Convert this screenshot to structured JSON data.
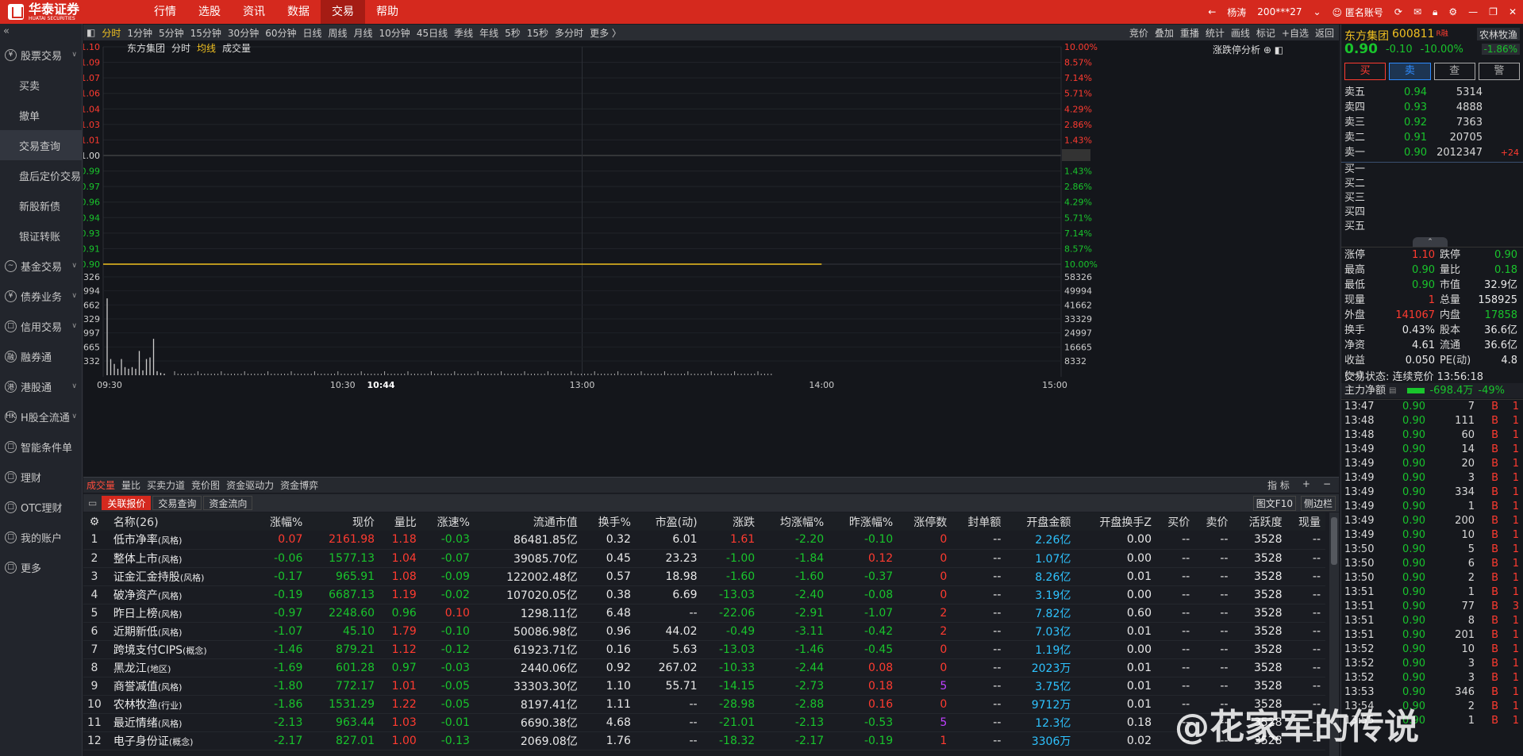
{
  "app": {
    "brand": "华泰证券",
    "brand_en": "HUATAI SECURITIES"
  },
  "menu": [
    {
      "label": "行情",
      "active": false
    },
    {
      "label": "选股",
      "active": false
    },
    {
      "label": "资讯",
      "active": false
    },
    {
      "label": "数据",
      "active": false
    },
    {
      "label": "交易",
      "active": true
    },
    {
      "label": "帮助",
      "active": false
    }
  ],
  "topright": {
    "user": "杨涛",
    "account": "200***27",
    "anon": "匿名账号"
  },
  "sidebar": [
    {
      "label": "股票交易",
      "icon": "¥",
      "chev": true,
      "sub": false
    },
    {
      "label": "买卖",
      "sub": true
    },
    {
      "label": "撤单",
      "sub": true
    },
    {
      "label": "交易查询",
      "sub": true,
      "active": true
    },
    {
      "label": "盘后定价交易",
      "sub": true
    },
    {
      "label": "新股新债",
      "sub": true
    },
    {
      "label": "银证转账",
      "sub": true
    },
    {
      "label": "基金交易",
      "icon": "~",
      "chev": true,
      "sub": false
    },
    {
      "label": "债券业务",
      "icon": "¥",
      "chev": true,
      "sub": false
    },
    {
      "label": "信用交易",
      "icon": "□",
      "chev": true,
      "sub": false
    },
    {
      "label": "融券通",
      "icon": "融",
      "sub": false
    },
    {
      "label": "港股通",
      "icon": "港",
      "chev": true,
      "sub": false
    },
    {
      "label": "H股全流通",
      "icon": "HK",
      "chev": true,
      "sub": false
    },
    {
      "label": "智能条件单",
      "icon": "□",
      "sub": false
    },
    {
      "label": "理财",
      "icon": "□",
      "sub": false
    },
    {
      "label": "OTC理财",
      "icon": "□",
      "sub": false
    },
    {
      "label": "我的账户",
      "icon": "□",
      "sub": false
    },
    {
      "label": "更多",
      "icon": "□",
      "sub": false
    }
  ],
  "chart_tools": {
    "periods": [
      "分时",
      "1分钟",
      "5分钟",
      "15分钟",
      "30分钟",
      "60分钟",
      "日线",
      "周线",
      "月线",
      "10分钟",
      "45日线",
      "季线",
      "年线",
      "5秒",
      "15秒",
      "多分时",
      "更多 〉"
    ],
    "right": [
      "竞价",
      "叠加",
      "重播",
      "统计",
      "画线",
      "标记",
      "+自选",
      "返回"
    ]
  },
  "chart_legend": {
    "name": "东方集团",
    "mode": "分时",
    "avg": "均线",
    "vol": "成交量",
    "right": "涨跌停分析"
  },
  "chart_data": {
    "type": "line",
    "title": "东方集团 分时",
    "price_ticks": [
      "1.10",
      "1.09",
      "1.07",
      "1.06",
      "1.04",
      "1.03",
      "1.01",
      "1.00",
      "0.99",
      "0.97",
      "0.96",
      "0.94",
      "0.93",
      "0.91",
      "0.90"
    ],
    "pct_ticks": [
      "10.00%",
      "8.57%",
      "7.14%",
      "5.71%",
      "4.29%",
      "2.86%",
      "1.43%",
      "1.00",
      "1.43%",
      "2.86%",
      "4.29%",
      "5.71%",
      "7.14%",
      "8.57%",
      "10.00%"
    ],
    "ylim": [
      0.9,
      1.1
    ],
    "prev_close": 1.0,
    "price_line": 0.9,
    "time_ticks": [
      "09:30",
      "10:30",
      "10:44",
      "13:00",
      "14:00",
      "15:00"
    ],
    "vol_ticks": [
      "58326",
      "49994",
      "41662",
      "33329",
      "24997",
      "16665",
      "8332"
    ],
    "vol_max": 58326,
    "vol_left": [
      "58326",
      "49994",
      "41662",
      "33329",
      "24997",
      "16665",
      "8332"
    ],
    "price_series_end": "14:00"
  },
  "ind_tabs": [
    "成交量",
    "量比",
    "买卖力道",
    "竞价图",
    "资金驱动力",
    "资金博弈"
  ],
  "ind_right": [
    "指 标",
    "+",
    "−"
  ],
  "tbl_tabs": [
    {
      "label": "关联报价",
      "on": true
    },
    {
      "label": "交易查询",
      "on": false
    },
    {
      "label": "资金流向",
      "on": false
    }
  ],
  "tbl_right": [
    "图文F10",
    "侧边栏"
  ],
  "table": {
    "headers": [
      "",
      "名称(26)",
      "涨幅%",
      "现价",
      "量比",
      "涨速%",
      "流通市值",
      "换手%",
      "市盈(动)",
      "涨跌",
      "均涨幅%",
      "昨涨幅%",
      "涨停数",
      "封单额",
      "开盘金额",
      "开盘换手Z",
      "买价",
      "卖价",
      "活跃度",
      "现量"
    ],
    "rows": [
      [
        "1",
        "低市净率",
        "风格",
        "0.07",
        "2161.98",
        "1.18",
        "-0.03",
        "86481.85亿",
        "0.32",
        "6.01",
        "1.61",
        "-2.20",
        "-0.10",
        "0",
        "--",
        "2.26亿",
        "0.00",
        "--",
        "--",
        "3528",
        "--"
      ],
      [
        "2",
        "整体上市",
        "风格",
        "-0.06",
        "1577.13",
        "1.04",
        "-0.07",
        "39085.70亿",
        "0.45",
        "23.23",
        "-1.00",
        "-1.84",
        "0.12",
        "0",
        "--",
        "1.07亿",
        "0.00",
        "--",
        "--",
        "3528",
        "--"
      ],
      [
        "3",
        "证金汇金持股",
        "风格",
        "-0.17",
        "965.91",
        "1.08",
        "-0.09",
        "122002.48亿",
        "0.57",
        "18.98",
        "-1.60",
        "-1.60",
        "-0.37",
        "0",
        "--",
        "8.26亿",
        "0.01",
        "--",
        "--",
        "3528",
        "--"
      ],
      [
        "4",
        "破净资产",
        "风格",
        "-0.19",
        "6687.13",
        "1.19",
        "-0.02",
        "107020.05亿",
        "0.38",
        "6.69",
        "-13.03",
        "-2.40",
        "-0.08",
        "0",
        "--",
        "3.19亿",
        "0.00",
        "--",
        "--",
        "3528",
        "--"
      ],
      [
        "5",
        "昨日上榜",
        "风格",
        "-0.97",
        "2248.60",
        "0.96",
        "0.10",
        "1298.11亿",
        "6.48",
        "--",
        "-22.06",
        "-2.91",
        "-1.07",
        "2",
        "--",
        "7.82亿",
        "0.60",
        "--",
        "--",
        "3528",
        "--"
      ],
      [
        "6",
        "近期新低",
        "风格",
        "-1.07",
        "45.10",
        "1.79",
        "-0.10",
        "50086.98亿",
        "0.96",
        "44.02",
        "-0.49",
        "-3.11",
        "-0.42",
        "2",
        "--",
        "7.03亿",
        "0.01",
        "--",
        "--",
        "3528",
        "--"
      ],
      [
        "7",
        "跨境支付CIPS",
        "概念",
        "-1.46",
        "879.21",
        "1.12",
        "-0.12",
        "61923.71亿",
        "0.16",
        "5.63",
        "-13.03",
        "-1.46",
        "-0.45",
        "0",
        "--",
        "1.19亿",
        "0.00",
        "--",
        "--",
        "3528",
        "--"
      ],
      [
        "8",
        "黑龙江",
        "地区",
        "-1.69",
        "601.28",
        "0.97",
        "-0.03",
        "2440.06亿",
        "0.92",
        "267.02",
        "-10.33",
        "-2.44",
        "0.08",
        "0",
        "--",
        "2023万",
        "0.01",
        "--",
        "--",
        "3528",
        "--"
      ],
      [
        "9",
        "商誉减值",
        "风格",
        "-1.80",
        "772.17",
        "1.01",
        "-0.05",
        "33303.30亿",
        "1.10",
        "55.71",
        "-14.15",
        "-2.73",
        "0.18",
        "5",
        "--",
        "3.75亿",
        "0.01",
        "--",
        "--",
        "3528",
        "--"
      ],
      [
        "10",
        "农林牧渔",
        "行业",
        "-1.86",
        "1531.29",
        "1.22",
        "-0.05",
        "8197.41亿",
        "1.11",
        "--",
        "-28.98",
        "-2.88",
        "0.16",
        "0",
        "--",
        "9712万",
        "0.01",
        "--",
        "--",
        "3528",
        "--"
      ],
      [
        "11",
        "最近情绪",
        "风格",
        "-2.13",
        "963.44",
        "1.03",
        "-0.01",
        "6690.38亿",
        "4.68",
        "--",
        "-21.01",
        "-2.13",
        "-0.53",
        "5",
        "--",
        "12.3亿",
        "0.18",
        "--",
        "--",
        "3528",
        "--"
      ],
      [
        "12",
        "电子身份证",
        "概念",
        "-2.17",
        "827.01",
        "1.00",
        "-0.13",
        "2069.08亿",
        "1.76",
        "--",
        "-18.32",
        "-2.17",
        "-0.19",
        "1",
        "--",
        "3306万",
        "0.02",
        "--",
        "--",
        "3528",
        "--"
      ]
    ]
  },
  "rp": {
    "name": "东方集团",
    "code": "600811",
    "tag": "R融",
    "price": "0.90",
    "chg": "-0.10",
    "pct": "-10.00%",
    "rel": "农林牧渔",
    "rel_pct": "-1.86%",
    "btns": [
      "买",
      "卖",
      "查",
      "警"
    ],
    "asks": [
      [
        "卖五",
        "0.94",
        "5314",
        ""
      ],
      [
        "卖四",
        "0.93",
        "4888",
        ""
      ],
      [
        "卖三",
        "0.92",
        "7363",
        ""
      ],
      [
        "卖二",
        "0.91",
        "20705",
        ""
      ],
      [
        "卖一",
        "0.90",
        "2012347",
        "+24"
      ]
    ],
    "bids": [
      "买一",
      "买二",
      "买三",
      "买四",
      "买五"
    ],
    "stats": [
      [
        "涨停",
        "1.10",
        "跌停",
        "0.90"
      ],
      [
        "最高",
        "0.90",
        "量比",
        "0.18"
      ],
      [
        "最低",
        "0.90",
        "市值",
        "32.9亿"
      ],
      [
        "现量",
        "1",
        "总量",
        "158925"
      ],
      [
        "外盘",
        "141067",
        "内盘",
        "17858"
      ],
      [
        "换手",
        "0.43%",
        "股本",
        "36.6亿"
      ],
      [
        "净资",
        "4.61",
        "流通",
        "36.6亿"
      ],
      [
        "收益(一)",
        "0.050",
        "PE(动)",
        "4.8"
      ]
    ],
    "state": "交易状态: 连续竞价 13:56:18",
    "flow_label": "主力净额",
    "flow_val": "-698.4万",
    "flow_pct": "-49%",
    "ticks": [
      [
        "13:47",
        "0.90",
        "7",
        "B",
        "1"
      ],
      [
        "13:48",
        "0.90",
        "111",
        "B",
        "1"
      ],
      [
        "13:48",
        "0.90",
        "60",
        "B",
        "1"
      ],
      [
        "13:49",
        "0.90",
        "14",
        "B",
        "1"
      ],
      [
        "13:49",
        "0.90",
        "20",
        "B",
        "1"
      ],
      [
        "13:49",
        "0.90",
        "3",
        "B",
        "1"
      ],
      [
        "13:49",
        "0.90",
        "334",
        "B",
        "1"
      ],
      [
        "13:49",
        "0.90",
        "1",
        "B",
        "1"
      ],
      [
        "13:49",
        "0.90",
        "200",
        "B",
        "1"
      ],
      [
        "13:49",
        "0.90",
        "10",
        "B",
        "1"
      ],
      [
        "13:50",
        "0.90",
        "5",
        "B",
        "1"
      ],
      [
        "13:50",
        "0.90",
        "6",
        "B",
        "1"
      ],
      [
        "13:50",
        "0.90",
        "2",
        "B",
        "1"
      ],
      [
        "13:51",
        "0.90",
        "1",
        "B",
        "1"
      ],
      [
        "13:51",
        "0.90",
        "77",
        "B",
        "3"
      ],
      [
        "13:51",
        "0.90",
        "8",
        "B",
        "1"
      ],
      [
        "13:51",
        "0.90",
        "201",
        "B",
        "1"
      ],
      [
        "13:52",
        "0.90",
        "10",
        "B",
        "1"
      ],
      [
        "13:52",
        "0.90",
        "3",
        "B",
        "1"
      ],
      [
        "13:52",
        "0.90",
        "3",
        "B",
        "1"
      ],
      [
        "13:53",
        "0.90",
        "346",
        "B",
        "1"
      ],
      [
        "13:54",
        "0.90",
        "2",
        "B",
        "1"
      ],
      [
        "13:55",
        "0.90",
        "1",
        "B",
        "1"
      ]
    ]
  },
  "watermark": "@花家军的传说"
}
